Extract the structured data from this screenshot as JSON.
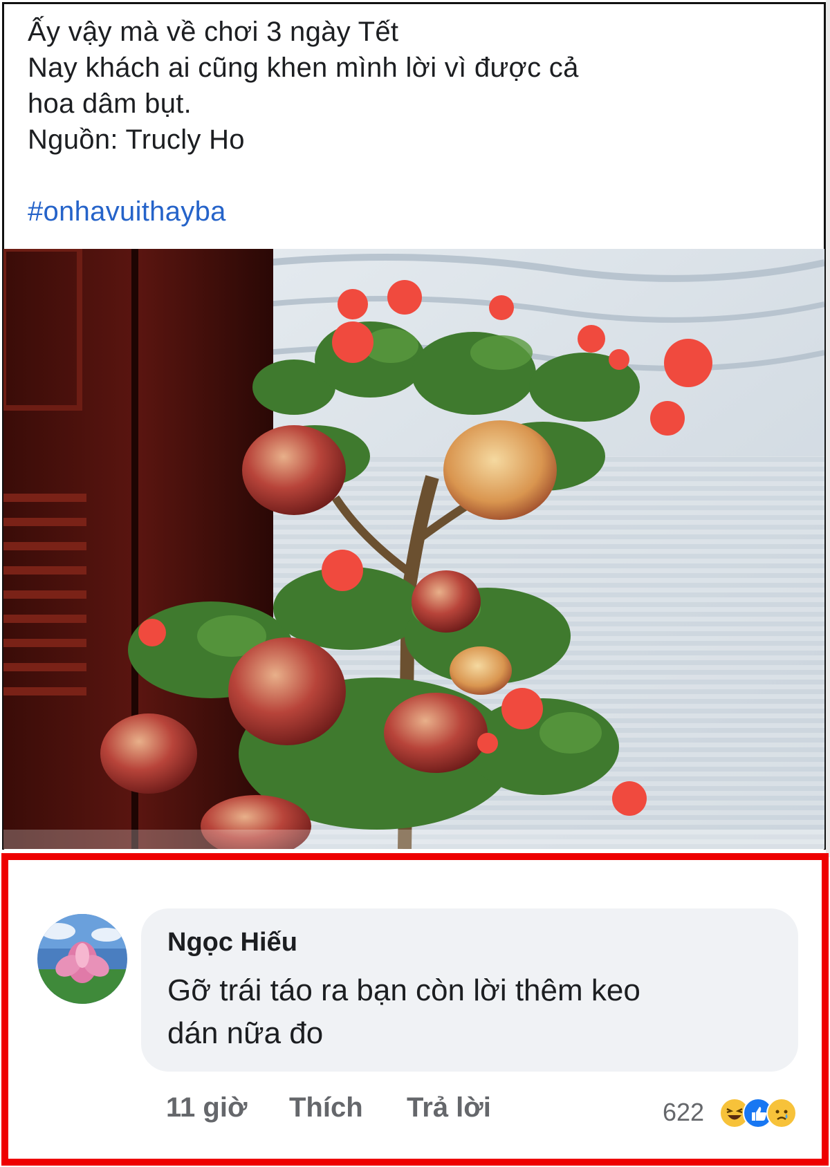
{
  "post": {
    "lines": [
      "Ấy vậy mà về chơi 3 ngày Tết",
      "Nay khách ai cũng khen mình lời vì được cả",
      "hoa dâm bụt.",
      "Nguồn: Trucly Ho"
    ],
    "hashtag": "#onhavuithayba"
  },
  "comment": {
    "author": "Ngọc Hiếu",
    "text_lines": [
      "Gỡ trái táo ra bạn còn lời thêm keo",
      "dán nữa đo"
    ],
    "time": "11 giờ",
    "like_label": "Thích",
    "reply_label": "Trả lời",
    "reaction_count": "622",
    "reaction_icons": [
      "haha-icon",
      "like-icon",
      "sad-icon"
    ]
  },
  "colors": {
    "highlight_border": "#ee0000",
    "hashtag": "#2563c9",
    "bubble": "#f0f2f5",
    "muted": "#65676b"
  }
}
